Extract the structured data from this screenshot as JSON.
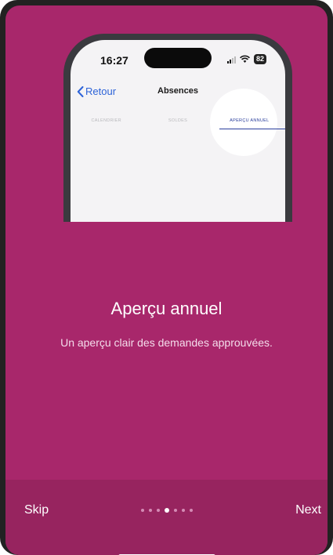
{
  "preview": {
    "time": "16:27",
    "battery": "82",
    "back_label": "Retour",
    "nav_title": "Absences",
    "tabs": [
      {
        "label": "CALENDRIER",
        "active": false
      },
      {
        "label": "SOLDES",
        "active": false
      },
      {
        "label": "APERÇU ANNUEL",
        "active": true
      }
    ]
  },
  "slide": {
    "title": "Aperçu annuel",
    "subtitle": "Un aperçu clair des demandes approuvées."
  },
  "footer": {
    "skip_label": "Skip",
    "next_label": "Next",
    "page_count": 7,
    "active_page": 4
  },
  "colors": {
    "background": "#a8276b",
    "footer": "#97245f",
    "accent_blue": "#2d63d8"
  }
}
